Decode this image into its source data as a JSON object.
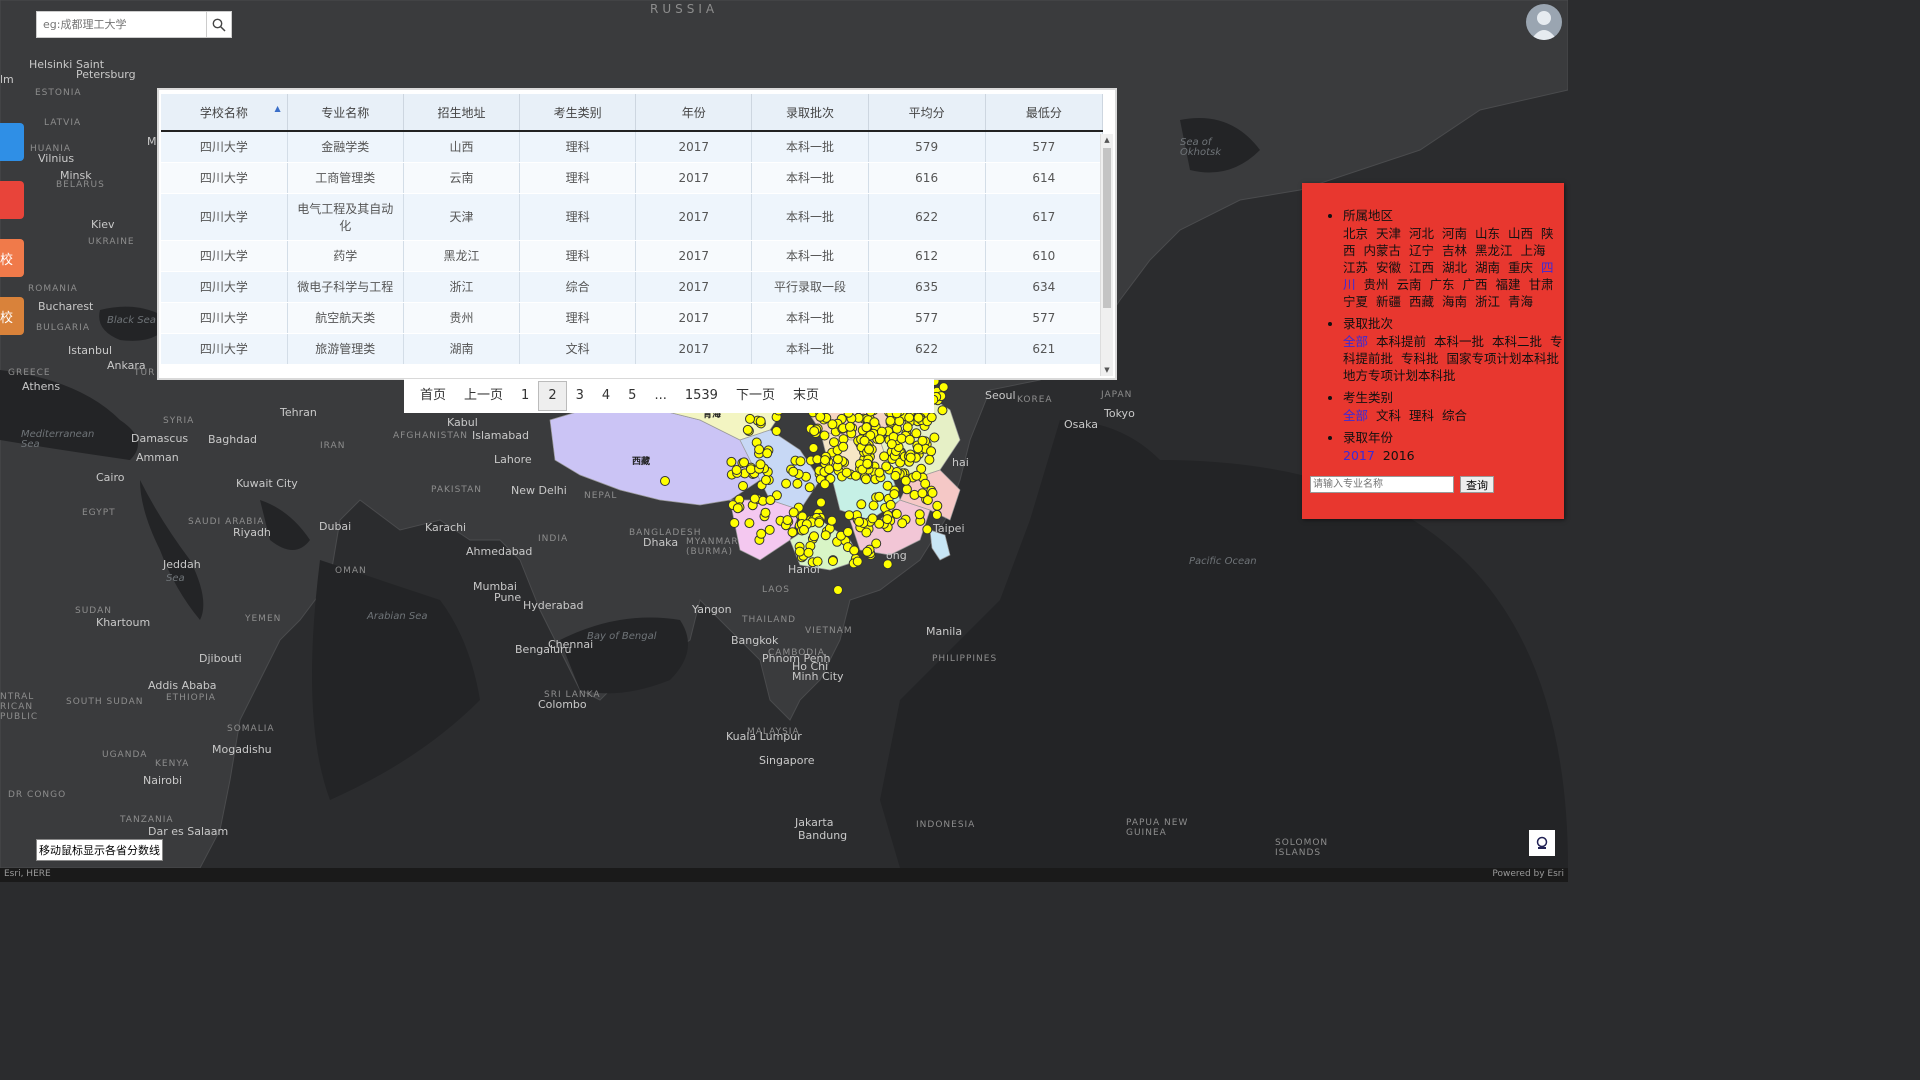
{
  "search": {
    "placeholder": "eg:成都理工大学"
  },
  "side_tabs": [
    {
      "label": "",
      "color": "#2f8fe6"
    },
    {
      "label": "",
      "color": "#e8443a"
    },
    {
      "label": "校",
      "color": "#f07a4a"
    },
    {
      "label": "校",
      "color": "#d9823a"
    }
  ],
  "grid": {
    "columns": [
      "学校名称",
      "专业名称",
      "招生地址",
      "考生类别",
      "年份",
      "录取批次",
      "平均分",
      "最低分"
    ],
    "rows": [
      [
        "四川大学",
        "金融学类",
        "山西",
        "理科",
        "2017",
        "本科一批",
        "579",
        "577"
      ],
      [
        "四川大学",
        "工商管理类",
        "云南",
        "理科",
        "2017",
        "本科一批",
        "616",
        "614"
      ],
      [
        "四川大学",
        "电气工程及其自动化",
        "天津",
        "理科",
        "2017",
        "本科一批",
        "622",
        "617"
      ],
      [
        "四川大学",
        "药学",
        "黑龙江",
        "理科",
        "2017",
        "本科一批",
        "612",
        "610"
      ],
      [
        "四川大学",
        "微电子科学与工程",
        "浙江",
        "综合",
        "2017",
        "平行录取一段",
        "635",
        "634"
      ],
      [
        "四川大学",
        "航空航天类",
        "贵州",
        "理科",
        "2017",
        "本科一批",
        "577",
        "577"
      ],
      [
        "四川大学",
        "旅游管理类",
        "湖南",
        "文科",
        "2017",
        "本科一批",
        "622",
        "621"
      ]
    ]
  },
  "pager": {
    "items": [
      "首页",
      "上一页",
      "1",
      "2",
      "3",
      "4",
      "5",
      "...",
      "1539",
      "下一页",
      "末页"
    ],
    "active": "2"
  },
  "filters": {
    "region_title": "所属地区",
    "regions": [
      "北京",
      "天津",
      "河北",
      "河南",
      "山东",
      "山西",
      "陕西",
      "内蒙古",
      "辽宁",
      "吉林",
      "黑龙江",
      "上海",
      "江苏",
      "安徽",
      "江西",
      "湖北",
      "湖南",
      "重庆",
      "四川",
      "贵州",
      "云南",
      "广东",
      "广西",
      "福建",
      "甘肃",
      "宁夏",
      "新疆",
      "西藏",
      "海南",
      "浙江",
      "青海"
    ],
    "region_selected": "四川",
    "batch_title": "录取批次",
    "batches": [
      "全部",
      "本科提前",
      "本科一批",
      "本科二批",
      "专科提前批",
      "专科批",
      "国家专项计划本科批",
      "地方专项计划本科批"
    ],
    "batch_selected": "全部",
    "type_title": "考生类别",
    "types": [
      "全部",
      "文科",
      "理科",
      "综合"
    ],
    "type_selected": "全部",
    "year_title": "录取年份",
    "years": [
      "2017",
      "2016"
    ],
    "year_selected": "2017",
    "query_placeholder": "请输入专业名称",
    "query_button": "查询"
  },
  "hint": "移动鼠标显示各省分数线",
  "attribution": {
    "left": "Esri, HERE",
    "right": "Powered by Esri"
  },
  "map_labels": {
    "russia": "RUSSIA",
    "helsinki": "Helsinki",
    "saint_petersburg": "Saint\nPetersburg",
    "estonia": "ESTONIA",
    "latvia": "LATVIA",
    "lithuania": "HUANIA",
    "vilnius": "Vilnius",
    "minsk": "Minsk",
    "belarus": "BELARUS",
    "kiev": "Kiev",
    "ukraine": "UKRAINE",
    "romania": "ROMANIA",
    "bucharest": "Bucharest",
    "bulgaria": "BULGARIA",
    "black_sea": "Black Sea",
    "istanbul": "Istanbul",
    "greece": "GREECE",
    "athens": "Athens",
    "ankara": "Ankara",
    "syria": "SYRIA",
    "mediterranean": "Mediterranean\nSea",
    "damascus": "Damascus",
    "baghdad": "Baghdad",
    "amman": "Amman",
    "tehran": "Tehran",
    "iran": "IRAN",
    "kabul": "Kabul",
    "islamabad": "Islamabad",
    "afghanistan": "AFGHANISTAN",
    "lahore": "Lahore",
    "cairo": "Cairo",
    "kuwait": "Kuwait City",
    "egypt": "EGYPT",
    "saudi": "SAUDI ARABIA",
    "riyadh": "Riyadh",
    "dubai": "Dubai",
    "karachi": "Karachi",
    "pakistan": "PAKISTAN",
    "new_delhi": "New Delhi",
    "nepal": "NEPAL",
    "ahmedabad": "Ahmedabad",
    "india": "INDIA",
    "oman": "OMAN",
    "jeddah": "Jeddah",
    "red_sea": "Sea",
    "mumbai": "Mumbai",
    "pune": "Pune",
    "hyderabad": "Hyderabad",
    "arabian_sea": "Arabian Sea",
    "sudan": "SUDAN",
    "khartoum": "Khartoum",
    "yemen": "YEMEN",
    "djibouti": "Djibouti",
    "addis": "Addis Ababa",
    "ethiopia": "ETHIOPIA",
    "south_sudan": "SOUTH SUDAN",
    "somalia": "SOMALIA",
    "mogadishu": "Mogadishu",
    "uganda": "UGANDA",
    "kenya": "KENYA",
    "nairobi": "Nairobi",
    "dr_congo": "DR CONGO",
    "tanzania": "TANZANIA",
    "dar": "Dar es Salaam",
    "car": "NTRAL\nRICAN\nPUBLIC",
    "bangalore": "Bengaluru",
    "chennai": "Chennai",
    "bay_bengal": "Bay of Bengal",
    "sri_lanka": "SRI LANKA",
    "colombo": "Colombo",
    "bangladesh": "BANGLADESH",
    "dhaka": "Dhaka",
    "myanmar": "MYANMAR\n(BURMA)",
    "yangon": "Yangon",
    "hanoi": "Hanoi",
    "laos": "LAOS",
    "thailand": "THAILAND",
    "bangkok": "Bangkok",
    "vietnam": "VIETNAM",
    "cambodia": "CAMBODIA",
    "phnom": "Phnom Penh",
    "hcm": "Ho Chi\nMinh City",
    "manila": "Manila",
    "philippines": "PHILIPPINES",
    "malaysia": "MALAYSIA",
    "kl": "Kuala Lumpur",
    "singapore": "Singapore",
    "jakarta": "Jakarta",
    "bandung": "Bandung",
    "indonesia": "INDONESIA",
    "png": "PAPUA NEW\nGUINEA",
    "solomon": "SOLOMON\nISLANDS",
    "pacific": "Pacific Ocean",
    "tokyo": "Tokyo",
    "osaka": "Osaka",
    "japan": "JAPAN",
    "seoul": "Seoul",
    "korea": "KOREA",
    "sea_okhotsk": "Sea of\nOkhotsk",
    "taipei": "Taipei",
    "hk": "ong",
    "shanghai": "hai",
    "xizang": "西藏",
    "qinghai": "青海",
    "lm": "lm",
    "m_left": "M",
    "tur": "TUR"
  }
}
